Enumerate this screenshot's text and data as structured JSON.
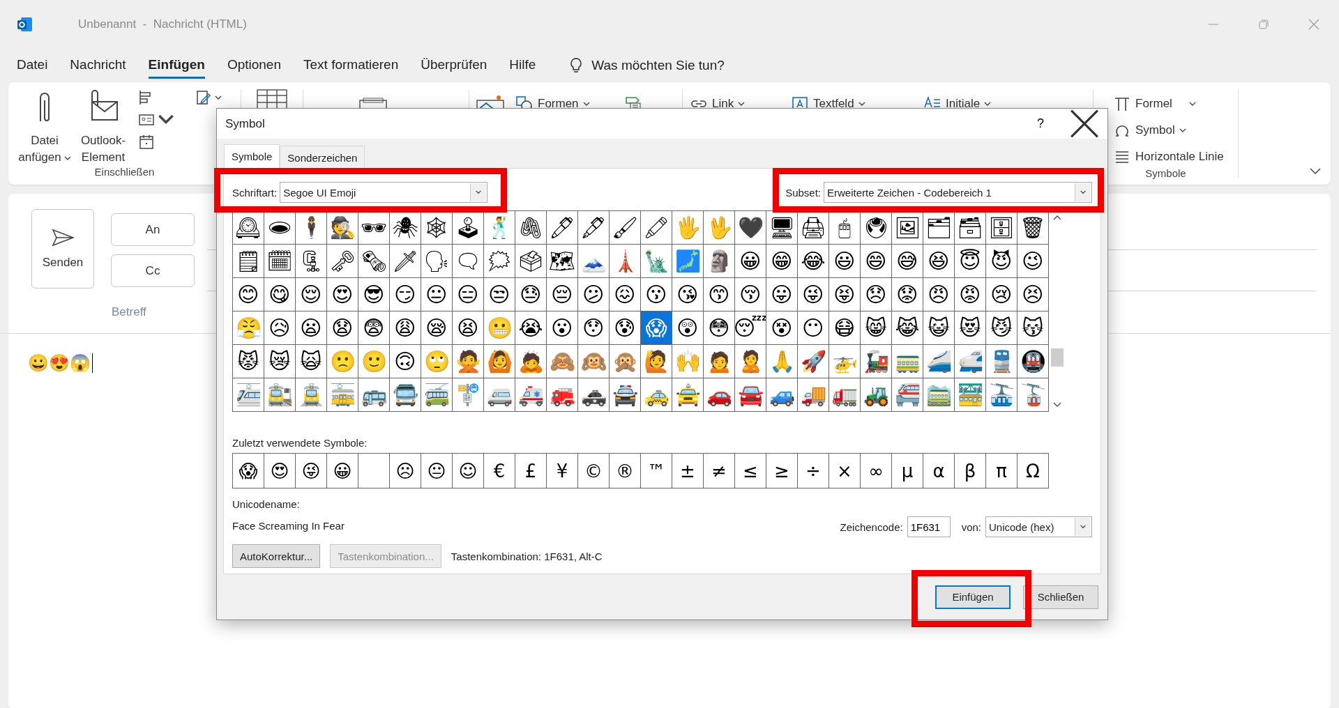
{
  "window": {
    "title": "Unbenannt  -  Nachricht (HTML)"
  },
  "menu_tabs": [
    {
      "label": "Datei",
      "selected": false
    },
    {
      "label": "Nachricht",
      "selected": false
    },
    {
      "label": "Einfügen",
      "selected": true
    },
    {
      "label": "Optionen",
      "selected": false
    },
    {
      "label": "Text formatieren",
      "selected": false
    },
    {
      "label": "Überprüfen",
      "selected": false
    },
    {
      "label": "Hilfe",
      "selected": false
    }
  ],
  "tell_me": "Was möchten Sie tun?",
  "ribbon": {
    "include_group": {
      "label": "Einschließen",
      "buttons": [
        {
          "label": "Datei anfügen",
          "dropdown": true
        },
        {
          "label": "Outlook-Element",
          "dropdown": false
        }
      ]
    },
    "insert_items": [
      {
        "label": "Formen",
        "dropdown": true
      },
      {
        "label": "Link",
        "dropdown": true
      },
      {
        "label": "Textfeld",
        "dropdown": true
      },
      {
        "label": "Initiale",
        "dropdown": true
      }
    ],
    "symbols_group": {
      "label": "Symbole",
      "items": [
        {
          "label": "Formel",
          "dropdown": true
        },
        {
          "label": "Symbol",
          "dropdown": true
        },
        {
          "label": "Horizontale Linie",
          "dropdown": false
        }
      ]
    }
  },
  "compose": {
    "send_button": "Senden",
    "address_buttons": [
      "An",
      "Cc"
    ],
    "subject_label": "Betreff",
    "body": "😀😍😱"
  },
  "dialog": {
    "title": "Symbol",
    "help": "?",
    "tabs": [
      {
        "label": "Symbole",
        "selected": true
      },
      {
        "label": "Sonderzeichen",
        "selected": false
      }
    ],
    "font": {
      "label": "Schriftart:",
      "value": "Segoe UI Emoji"
    },
    "subset": {
      "label": "Subset:",
      "value": "Erweiterte Zeichen - Codebereich 1"
    },
    "grid": [
      [
        {
          "char": "🕰",
          "selected": false
        },
        {
          "char": "🕳",
          "selected": false
        },
        {
          "char": "🕴",
          "selected": false
        },
        {
          "char": "🕵",
          "selected": false
        },
        {
          "char": "🕶",
          "selected": false
        },
        {
          "char": "🕷",
          "selected": false
        },
        {
          "char": "🕸",
          "selected": false
        },
        {
          "char": "🕹",
          "selected": false
        },
        {
          "char": "🕺",
          "selected": false
        },
        {
          "char": "🖇",
          "selected": false
        },
        {
          "char": "🖊",
          "selected": false
        },
        {
          "char": "🖋",
          "selected": false
        },
        {
          "char": "🖌",
          "selected": false
        },
        {
          "char": "🖍",
          "selected": false
        },
        {
          "char": "🖐",
          "selected": false
        },
        {
          "char": "🖖",
          "selected": false
        },
        {
          "char": "🖤",
          "selected": false
        },
        {
          "char": "🖥",
          "selected": false
        },
        {
          "char": "🖨",
          "selected": false
        },
        {
          "char": "🖱",
          "selected": false
        },
        {
          "char": "🖲",
          "selected": false
        },
        {
          "char": "🖼",
          "selected": false
        },
        {
          "char": "🗂",
          "selected": false
        },
        {
          "char": "🗃",
          "selected": false
        },
        {
          "char": "🗄",
          "selected": false
        },
        {
          "char": "🗑",
          "selected": false
        }
      ],
      [
        {
          "char": "🗒",
          "selected": false
        },
        {
          "char": "🗓",
          "selected": false
        },
        {
          "char": "🗜",
          "selected": false
        },
        {
          "char": "🗝",
          "selected": false
        },
        {
          "char": "🗞",
          "selected": false
        },
        {
          "char": "🗡",
          "selected": false
        },
        {
          "char": "🗣",
          "selected": false
        },
        {
          "char": "🗨",
          "selected": false
        },
        {
          "char": "🗯",
          "selected": false
        },
        {
          "char": "🗳",
          "selected": false
        },
        {
          "char": "🗺",
          "selected": false
        },
        {
          "char": "🗻",
          "selected": false
        },
        {
          "char": "🗼",
          "selected": false
        },
        {
          "char": "🗽",
          "selected": false
        },
        {
          "char": "🗾",
          "selected": false
        },
        {
          "char": "🗿",
          "selected": false
        },
        {
          "char": "😀",
          "selected": false
        },
        {
          "char": "😁",
          "selected": false
        },
        {
          "char": "😂",
          "selected": false
        },
        {
          "char": "😃",
          "selected": false
        },
        {
          "char": "😄",
          "selected": false
        },
        {
          "char": "😅",
          "selected": false
        },
        {
          "char": "😆",
          "selected": false
        },
        {
          "char": "😇",
          "selected": false
        },
        {
          "char": "😈",
          "selected": false
        },
        {
          "char": "😉",
          "selected": false
        }
      ],
      [
        {
          "char": "😊",
          "selected": false
        },
        {
          "char": "😋",
          "selected": false
        },
        {
          "char": "😌",
          "selected": false
        },
        {
          "char": "😍",
          "selected": false
        },
        {
          "char": "😎",
          "selected": false
        },
        {
          "char": "😏",
          "selected": false
        },
        {
          "char": "😐",
          "selected": false
        },
        {
          "char": "😑",
          "selected": false
        },
        {
          "char": "😒",
          "selected": false
        },
        {
          "char": "😓",
          "selected": false
        },
        {
          "char": "😔",
          "selected": false
        },
        {
          "char": "😕",
          "selected": false
        },
        {
          "char": "😖",
          "selected": false
        },
        {
          "char": "😗",
          "selected": false
        },
        {
          "char": "😘",
          "selected": false
        },
        {
          "char": "😙",
          "selected": false
        },
        {
          "char": "😚",
          "selected": false
        },
        {
          "char": "😛",
          "selected": false
        },
        {
          "char": "😜",
          "selected": false
        },
        {
          "char": "😝",
          "selected": false
        },
        {
          "char": "😞",
          "selected": false
        },
        {
          "char": "😟",
          "selected": false
        },
        {
          "char": "😠",
          "selected": false
        },
        {
          "char": "😡",
          "selected": false
        },
        {
          "char": "😢",
          "selected": false
        },
        {
          "char": "😣",
          "selected": false
        }
      ],
      [
        {
          "char": "😤",
          "selected": false
        },
        {
          "char": "😥",
          "selected": false
        },
        {
          "char": "😦",
          "selected": false
        },
        {
          "char": "😧",
          "selected": false
        },
        {
          "char": "😨",
          "selected": false
        },
        {
          "char": "😩",
          "selected": false
        },
        {
          "char": "😪",
          "selected": false
        },
        {
          "char": "😫",
          "selected": false
        },
        {
          "char": "😬",
          "selected": false
        },
        {
          "char": "😭",
          "selected": false
        },
        {
          "char": "😮",
          "selected": false
        },
        {
          "char": "😯",
          "selected": false
        },
        {
          "char": "😰",
          "selected": false
        },
        {
          "char": "😱",
          "selected": true
        },
        {
          "char": "😲",
          "selected": false
        },
        {
          "char": "😳",
          "selected": false
        },
        {
          "char": "😴",
          "selected": false
        },
        {
          "char": "😵",
          "selected": false
        },
        {
          "char": "😶",
          "selected": false
        },
        {
          "char": "😷",
          "selected": false
        },
        {
          "char": "😸",
          "selected": false
        },
        {
          "char": "😹",
          "selected": false
        },
        {
          "char": "😺",
          "selected": false
        },
        {
          "char": "😻",
          "selected": false
        },
        {
          "char": "😼",
          "selected": false
        },
        {
          "char": "😽",
          "selected": false
        }
      ],
      [
        {
          "char": "😾",
          "selected": false
        },
        {
          "char": "😿",
          "selected": false
        },
        {
          "char": "🙀",
          "selected": false
        },
        {
          "char": "🙁",
          "selected": false
        },
        {
          "char": "🙂",
          "selected": false
        },
        {
          "char": "🙃",
          "selected": false
        },
        {
          "char": "🙄",
          "selected": false
        },
        {
          "char": "🙅",
          "selected": false
        },
        {
          "char": "🙆",
          "selected": false
        },
        {
          "char": "🙇",
          "selected": false
        },
        {
          "char": "🙈",
          "selected": false
        },
        {
          "char": "🙉",
          "selected": false
        },
        {
          "char": "🙊",
          "selected": false
        },
        {
          "char": "🙋",
          "selected": false
        },
        {
          "char": "🙌",
          "selected": false
        },
        {
          "char": "🙍",
          "selected": false
        },
        {
          "char": "🙎",
          "selected": false
        },
        {
          "char": "🙏",
          "selected": false
        },
        {
          "char": "🚀",
          "selected": false
        },
        {
          "char": "🚁",
          "selected": false
        },
        {
          "char": "🚂",
          "selected": false
        },
        {
          "char": "🚃",
          "selected": false
        },
        {
          "char": "🚄",
          "selected": false
        },
        {
          "char": "🚅",
          "selected": false
        },
        {
          "char": "🚆",
          "selected": false
        },
        {
          "char": "🚇",
          "selected": false
        }
      ],
      [
        {
          "char": "🚈",
          "selected": false
        },
        {
          "char": "🚉",
          "selected": false
        },
        {
          "char": "🚊",
          "selected": false
        },
        {
          "char": "🚋",
          "selected": false
        },
        {
          "char": "🚌",
          "selected": false
        },
        {
          "char": "🚍",
          "selected": false
        },
        {
          "char": "🚎",
          "selected": false
        },
        {
          "char": "🚏",
          "selected": false
        },
        {
          "char": "🚐",
          "selected": false
        },
        {
          "char": "🚑",
          "selected": false
        },
        {
          "char": "🚒",
          "selected": false
        },
        {
          "char": "🚓",
          "selected": false
        },
        {
          "char": "🚔",
          "selected": false
        },
        {
          "char": "🚕",
          "selected": false
        },
        {
          "char": "🚖",
          "selected": false
        },
        {
          "char": "🚗",
          "selected": false
        },
        {
          "char": "🚘",
          "selected": false
        },
        {
          "char": "🚙",
          "selected": false
        },
        {
          "char": "🚚",
          "selected": false
        },
        {
          "char": "🚛",
          "selected": false
        },
        {
          "char": "🚜",
          "selected": false
        },
        {
          "char": "🚝",
          "selected": false
        },
        {
          "char": "🚞",
          "selected": false
        },
        {
          "char": "🚟",
          "selected": false
        },
        {
          "char": "🚠",
          "selected": false
        },
        {
          "char": "🚡",
          "selected": false
        }
      ]
    ],
    "recent": {
      "label": "Zuletzt verwendete Symbole:",
      "items": [
        {
          "kind": "glyph",
          "char": "😱"
        },
        {
          "kind": "glyph",
          "char": "😍"
        },
        {
          "kind": "glyph",
          "char": "😜"
        },
        {
          "kind": "glyph",
          "char": "😀"
        },
        {
          "kind": "empty"
        },
        {
          "kind": "glyph",
          "char": "☹"
        },
        {
          "kind": "glyph",
          "char": "😐"
        },
        {
          "kind": "glyph",
          "char": "☺"
        },
        {
          "kind": "glyph",
          "char": "€"
        },
        {
          "kind": "glyph",
          "char": "£"
        },
        {
          "kind": "glyph",
          "char": "¥"
        },
        {
          "kind": "glyph",
          "char": "©"
        },
        {
          "kind": "glyph",
          "char": "®"
        },
        {
          "kind": "glyph",
          "char": "™"
        },
        {
          "kind": "glyph",
          "char": "±"
        },
        {
          "kind": "glyph",
          "char": "≠"
        },
        {
          "kind": "glyph",
          "char": "≤"
        },
        {
          "kind": "glyph",
          "char": "≥"
        },
        {
          "kind": "glyph",
          "char": "÷"
        },
        {
          "kind": "glyph",
          "char": "×"
        },
        {
          "kind": "glyph",
          "char": "∞"
        },
        {
          "kind": "glyph",
          "char": "µ"
        },
        {
          "kind": "glyph",
          "char": "α"
        },
        {
          "kind": "glyph",
          "char": "β"
        },
        {
          "kind": "glyph",
          "char": "π"
        },
        {
          "kind": "glyph",
          "char": "Ω"
        }
      ]
    },
    "unicode_name": {
      "label": "Unicodename:",
      "value": "Face Screaming In Fear"
    },
    "char_code": {
      "label": "Zeichencode:",
      "value": "1F631"
    },
    "code_from": {
      "label": "von:",
      "value": "Unicode (hex)"
    },
    "action_buttons": [
      {
        "label": "AutoKorrektur...",
        "disabled": false
      },
      {
        "label": "Tastenkombination...",
        "disabled": true
      }
    ],
    "shortcut_text": "Tastenkombination: 1F631, Alt-C",
    "footer_buttons": [
      {
        "label": "Einfügen",
        "default": true
      },
      {
        "label": "Schließen",
        "default": false
      }
    ]
  }
}
